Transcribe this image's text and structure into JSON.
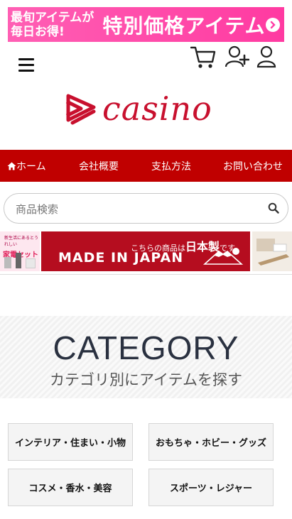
{
  "promo": {
    "line1": "最旬アイテムが",
    "line2": "毎日お得!",
    "headline": "特別価格アイテム"
  },
  "header": {
    "menu_icon": "hamburger-icon",
    "cart_icon": "cart-icon",
    "register_icon": "add-user-icon",
    "account_icon": "user-icon"
  },
  "logo": {
    "text": "casino",
    "color": "#c8102e"
  },
  "nav": {
    "items": [
      {
        "label": "ホーム",
        "icon": "home-icon"
      },
      {
        "label": "会社概要"
      },
      {
        "label": "支払方法"
      },
      {
        "label": "お問い合わせ"
      }
    ],
    "background": "#c00000"
  },
  "search": {
    "placeholder": "商品検索",
    "value": ""
  },
  "banners": {
    "left": {
      "line1": "新生活にあるとうれしい",
      "line2": "家電セット"
    },
    "main": {
      "small_prefix": "こちらの商品は",
      "small_emphasis": "日本製",
      "small_suffix": "です。",
      "big": "MADE IN JAPAN"
    }
  },
  "category": {
    "title": "CATEGORY",
    "subtitle": "カテゴリ別にアイテムを探す",
    "items": [
      "インテリア・住まい・小物",
      "おもちゃ・ホビー・グッズ",
      "コスメ・香水・美容",
      "スポーツ・レジャー"
    ]
  },
  "colors": {
    "accent": "#c00000",
    "promo": "#ff3fa6"
  }
}
